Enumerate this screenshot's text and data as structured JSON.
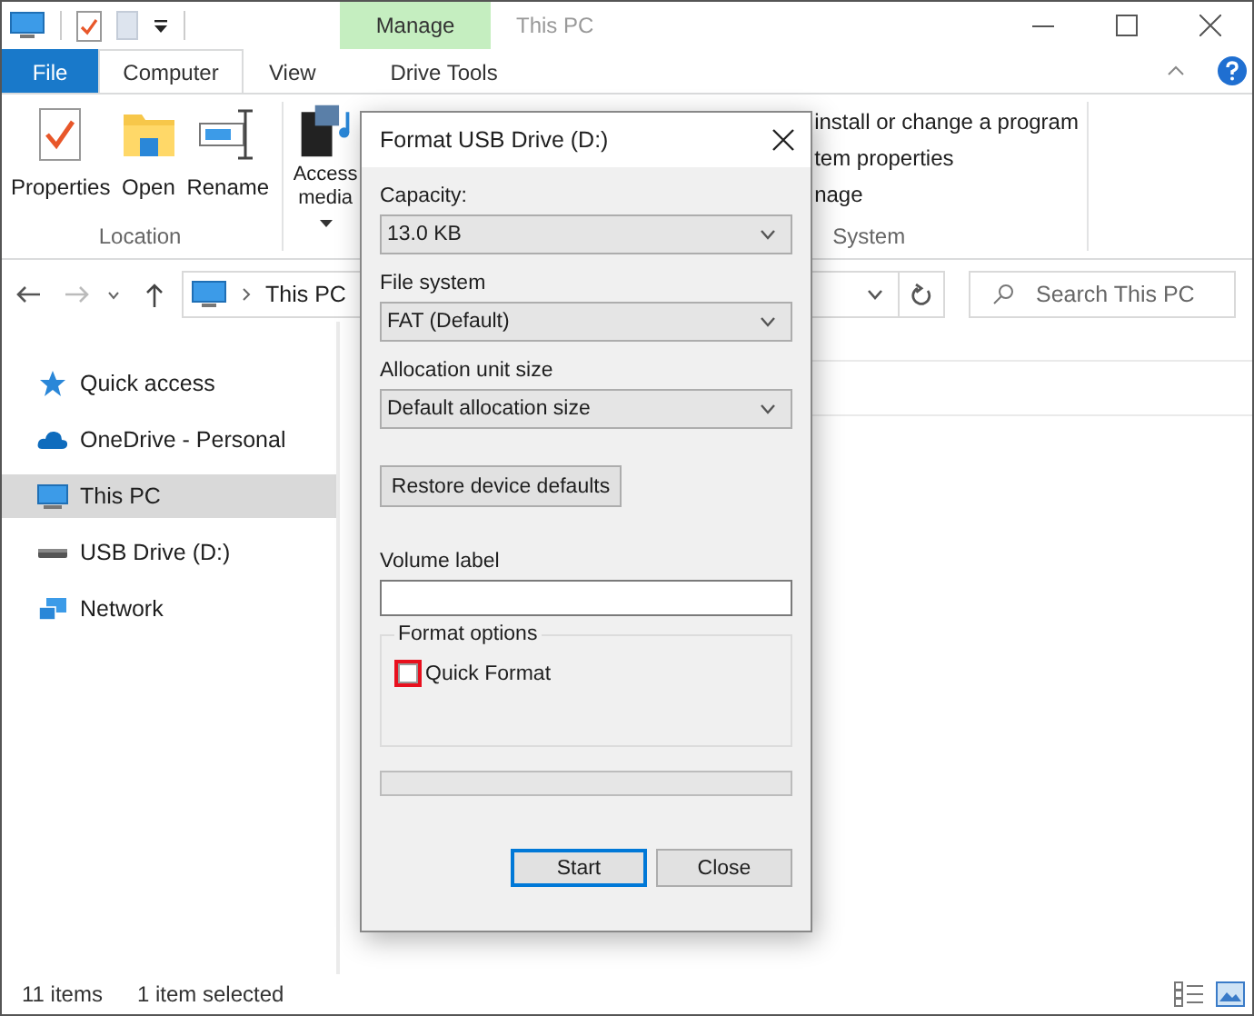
{
  "window": {
    "title": "This PC",
    "context_tab": "Manage"
  },
  "ribbon_tabs": [
    {
      "label": "File",
      "kind": "file",
      "selected": false
    },
    {
      "label": "Computer",
      "kind": "tab",
      "selected": true
    },
    {
      "label": "View",
      "kind": "tab",
      "selected": false
    },
    {
      "label": "Drive Tools",
      "kind": "context",
      "selected": false
    }
  ],
  "ribbon": {
    "location_group": {
      "label": "Location",
      "items": [
        {
          "label": "Properties",
          "kind": "properties"
        },
        {
          "label": "Open",
          "kind": "open"
        },
        {
          "label": "Rename",
          "kind": "rename"
        }
      ]
    },
    "media_item": {
      "label": "Access media"
    },
    "system_group": {
      "label": "System",
      "items": [
        "install or change a program",
        "tem properties",
        "nage"
      ]
    }
  },
  "address": {
    "location": "This PC"
  },
  "search": {
    "placeholder": "Search This PC"
  },
  "sidebar": [
    {
      "label": "Quick access",
      "kind": "star",
      "selected": false
    },
    {
      "label": "OneDrive - Personal",
      "kind": "cloud",
      "selected": false
    },
    {
      "label": "This PC",
      "kind": "pc",
      "selected": true
    },
    {
      "label": "USB Drive (D:)",
      "kind": "drive",
      "selected": false
    },
    {
      "label": "Network",
      "kind": "network",
      "selected": false
    }
  ],
  "status_bar": [
    "11 items",
    "1 item selected"
  ],
  "dialog": {
    "title": "Format USB Drive (D:)",
    "dropdowns": [
      {
        "label": "Capacity:",
        "value": "13.0 KB"
      },
      {
        "label": "File system",
        "value": "FAT (Default)"
      },
      {
        "label": "Allocation unit size",
        "value": "Default allocation size"
      }
    ],
    "restore_button": "Restore device defaults",
    "volume_label": {
      "label": "Volume label"
    },
    "format_options": {
      "label": "Format options",
      "checkboxes": [
        {
          "label": "Quick Format",
          "checked": false,
          "highlighted": true
        }
      ]
    },
    "progress": {
      "level": 0
    },
    "buttons": [
      {
        "label": "Start",
        "default": true
      },
      {
        "label": "Close",
        "default": false
      }
    ]
  }
}
